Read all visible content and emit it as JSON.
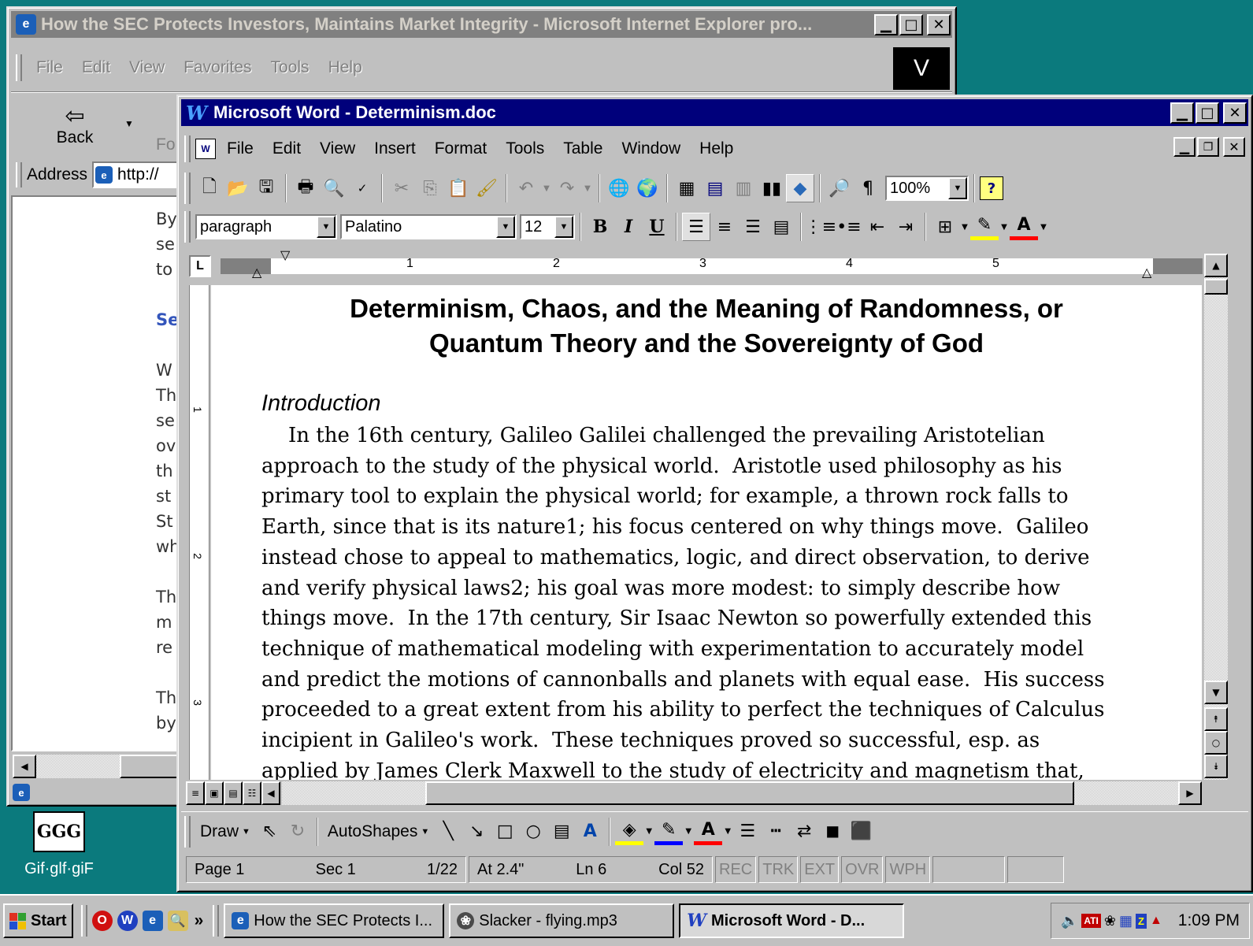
{
  "ie": {
    "title": "How the SEC Protects Investors, Maintains Market Integrity - Microsoft Internet Explorer pro...",
    "menu": [
      "File",
      "Edit",
      "View",
      "Favorites",
      "Tools",
      "Help"
    ],
    "brand": "V",
    "back_label": "Back",
    "forward_label": "For",
    "address_label": "Address",
    "address_value": "http://",
    "body_fragments": [
      "By",
      "se",
      "to",
      "Se",
      "W",
      "Th",
      "se",
      "ov",
      "th",
      "st",
      "St",
      "wh",
      "Th",
      "m",
      "re",
      "Th",
      "by"
    ]
  },
  "word": {
    "title": "Microsoft Word - Determinism.doc",
    "menu": [
      "File",
      "Edit",
      "View",
      "Insert",
      "Format",
      "Tools",
      "Table",
      "Window",
      "Help"
    ],
    "zoom": "100%",
    "style_value": "paragraph",
    "font_value": "Palatino",
    "size_value": "12",
    "ruler_numbers": [
      "1",
      "2",
      "3",
      "4",
      "5"
    ],
    "document": {
      "title_line1": "Determinism, Chaos, and the Meaning of Randomness, or",
      "title_line2": "Quantum Theory and the Sovereignty of God",
      "heading": "Introduction",
      "lines": [
        "In the 16th century, Galileo Galilei challenged the prevailing Aristotelian",
        "approach to the study of the physical world.  Aristotle used philosophy as his",
        "primary tool to explain the physical world; for example, a thrown rock falls to",
        "Earth, since that is its nature1; his focus centered on why things move.  Galileo",
        "instead chose to appeal to mathematics, logic, and direct observation, to derive",
        "and verify physical laws2; his goal was more modest: to simply describe how",
        "things move.  In the 17th century, Sir Isaac Newton so powerfully extended this",
        "technique of mathematical modeling with experimentation to accurately model",
        "and predict the motions of cannonballs and planets with equal ease.  His success",
        "proceeded to a great extent from his ability to perfect the techniques of Calculus",
        "incipient in Galileo's work.  These techniques proved so successful, esp. as",
        "applied by James Clerk Maxwell to the study of electricity and magnetism that,"
      ]
    },
    "drawing": {
      "draw_label": "Draw",
      "autoshapes_label": "AutoShapes"
    },
    "status": {
      "page": "Page 1",
      "sec": "Sec 1",
      "pages": "1/22",
      "at": "At 2.4\"",
      "ln": "Ln 6",
      "col": "Col 52",
      "rec": "REC",
      "trk": "TRK",
      "ext": "EXT",
      "ovr": "OVR",
      "wph": "WPH"
    }
  },
  "desktop": {
    "icon_label": "Gif·glf·giF"
  },
  "taskbar": {
    "start_label": "Start",
    "chevron": "»",
    "tasks": [
      "How the SEC Protects I...",
      "Slacker - flying.mp3",
      "Microsoft Word - D..."
    ],
    "clock": "1:09 PM"
  },
  "colors": {
    "desktop": "#0b7a7d",
    "active_title": "#00007b",
    "inactive_title": "#808080"
  }
}
